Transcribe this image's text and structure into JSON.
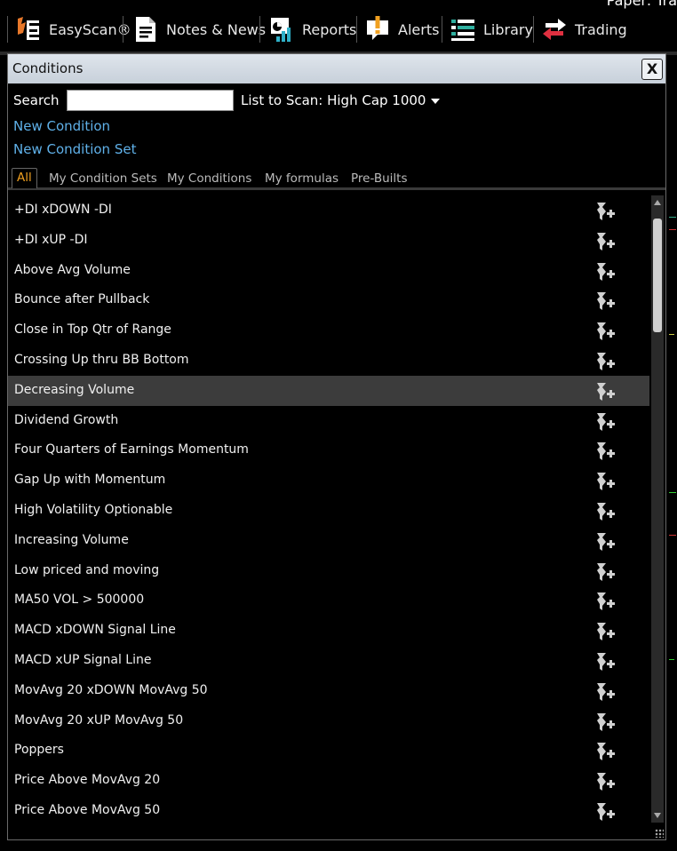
{
  "toolbar": {
    "paper_text": "Paper: Tra",
    "items": [
      {
        "label": "EasyScan®",
        "icon": "easyscan-icon"
      },
      {
        "label": "Notes & News",
        "icon": "notes-icon"
      },
      {
        "label": "Reports",
        "icon": "reports-icon"
      },
      {
        "label": "Alerts",
        "icon": "alerts-icon"
      },
      {
        "label": "Library",
        "icon": "library-icon"
      },
      {
        "label": "Trading",
        "icon": "trading-icon"
      }
    ]
  },
  "dialog": {
    "title": "Conditions",
    "close_label": "X",
    "search_label": "Search",
    "search_value": "",
    "scan_list": "List to Scan: High Cap 1000",
    "new_condition": "New Condition",
    "new_condition_set": "New Condition Set",
    "tabs": [
      "All",
      "My Condition Sets",
      "My Conditions",
      "My formulas",
      "Pre-Builts"
    ],
    "active_tab": "All",
    "selected_item": "Decreasing Volume",
    "items": [
      "+DI xDOWN -DI",
      "+DI xUP -DI",
      "Above Avg Volume",
      "Bounce after Pullback",
      "Close in Top Qtr of Range",
      "Crossing Up thru BB Bottom",
      "Decreasing Volume",
      "Dividend Growth",
      "Four Quarters of Earnings Momentum",
      "Gap Up with Momentum",
      "High Volatility Optionable",
      "Increasing Volume",
      "Low priced and moving",
      "MA50 VOL > 500000",
      "MACD xDOWN Signal Line",
      "MACD xUP Signal Line",
      "MovAvg 20 xDOWN MovAvg 50",
      "MovAvg 20 xUP MovAvg 50",
      "Poppers",
      "Price Above MovAvg 20",
      "Price Above MovAvg 50"
    ]
  },
  "colors": {
    "link": "#5fb0e8",
    "active_tab": "#f0a020",
    "selected_row": "#3c3c3c"
  }
}
